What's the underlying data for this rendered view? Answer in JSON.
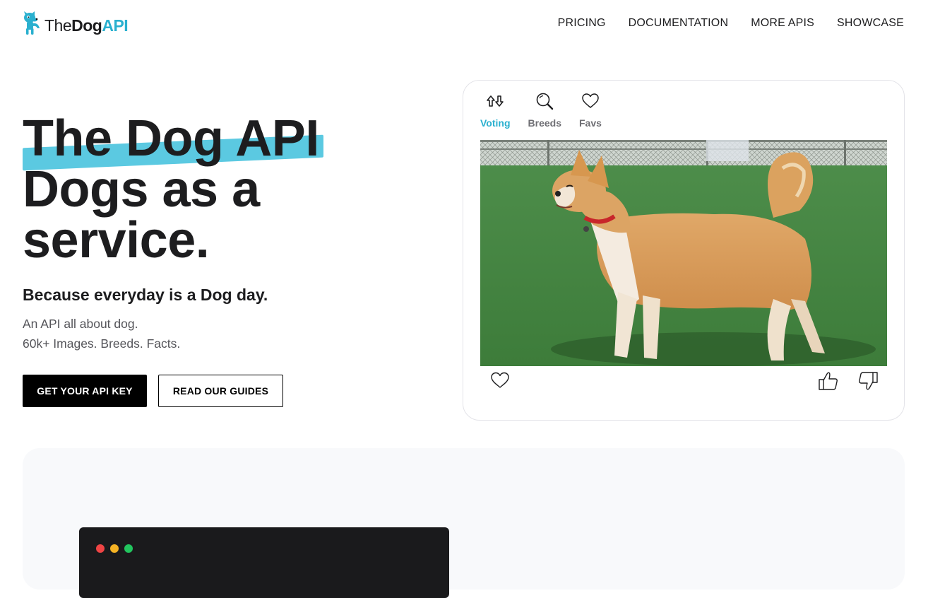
{
  "header": {
    "logo": {
      "the": "The",
      "dog": "Dog",
      "api": "API"
    },
    "nav": [
      "PRICING",
      "DOCUMENTATION",
      "MORE APIS",
      "SHOWCASE"
    ]
  },
  "hero": {
    "title_lines": [
      "The Dog API",
      "Dogs as a",
      "service."
    ],
    "tagline": "Because everyday is a Dog day.",
    "subtext": [
      "An API all about dog.",
      "60k+ Images. Breeds. Facts."
    ],
    "primary_button": "GET YOUR API KEY",
    "secondary_button": "READ OUR GUIDES"
  },
  "voting_card": {
    "tabs": [
      {
        "label": "Voting",
        "icon": "vote-arrows-icon",
        "active": true
      },
      {
        "label": "Breeds",
        "icon": "search-icon",
        "active": false
      },
      {
        "label": "Favs",
        "icon": "heart-icon",
        "active": false
      }
    ],
    "image_subject": "shiba-inu-dog-photo",
    "actions": [
      "heart-icon",
      "thumbs-up-icon",
      "thumbs-down-icon"
    ]
  },
  "code_window": {
    "dots": [
      "red",
      "yellow",
      "green"
    ]
  },
  "colors": {
    "accent": "#2ab0cf",
    "highlight": "#5bc9e1",
    "text": "#1d1d1f",
    "muted": "#55555a",
    "lower_bg": "#f8f9fb",
    "code_bg": "#1a1a1c"
  }
}
